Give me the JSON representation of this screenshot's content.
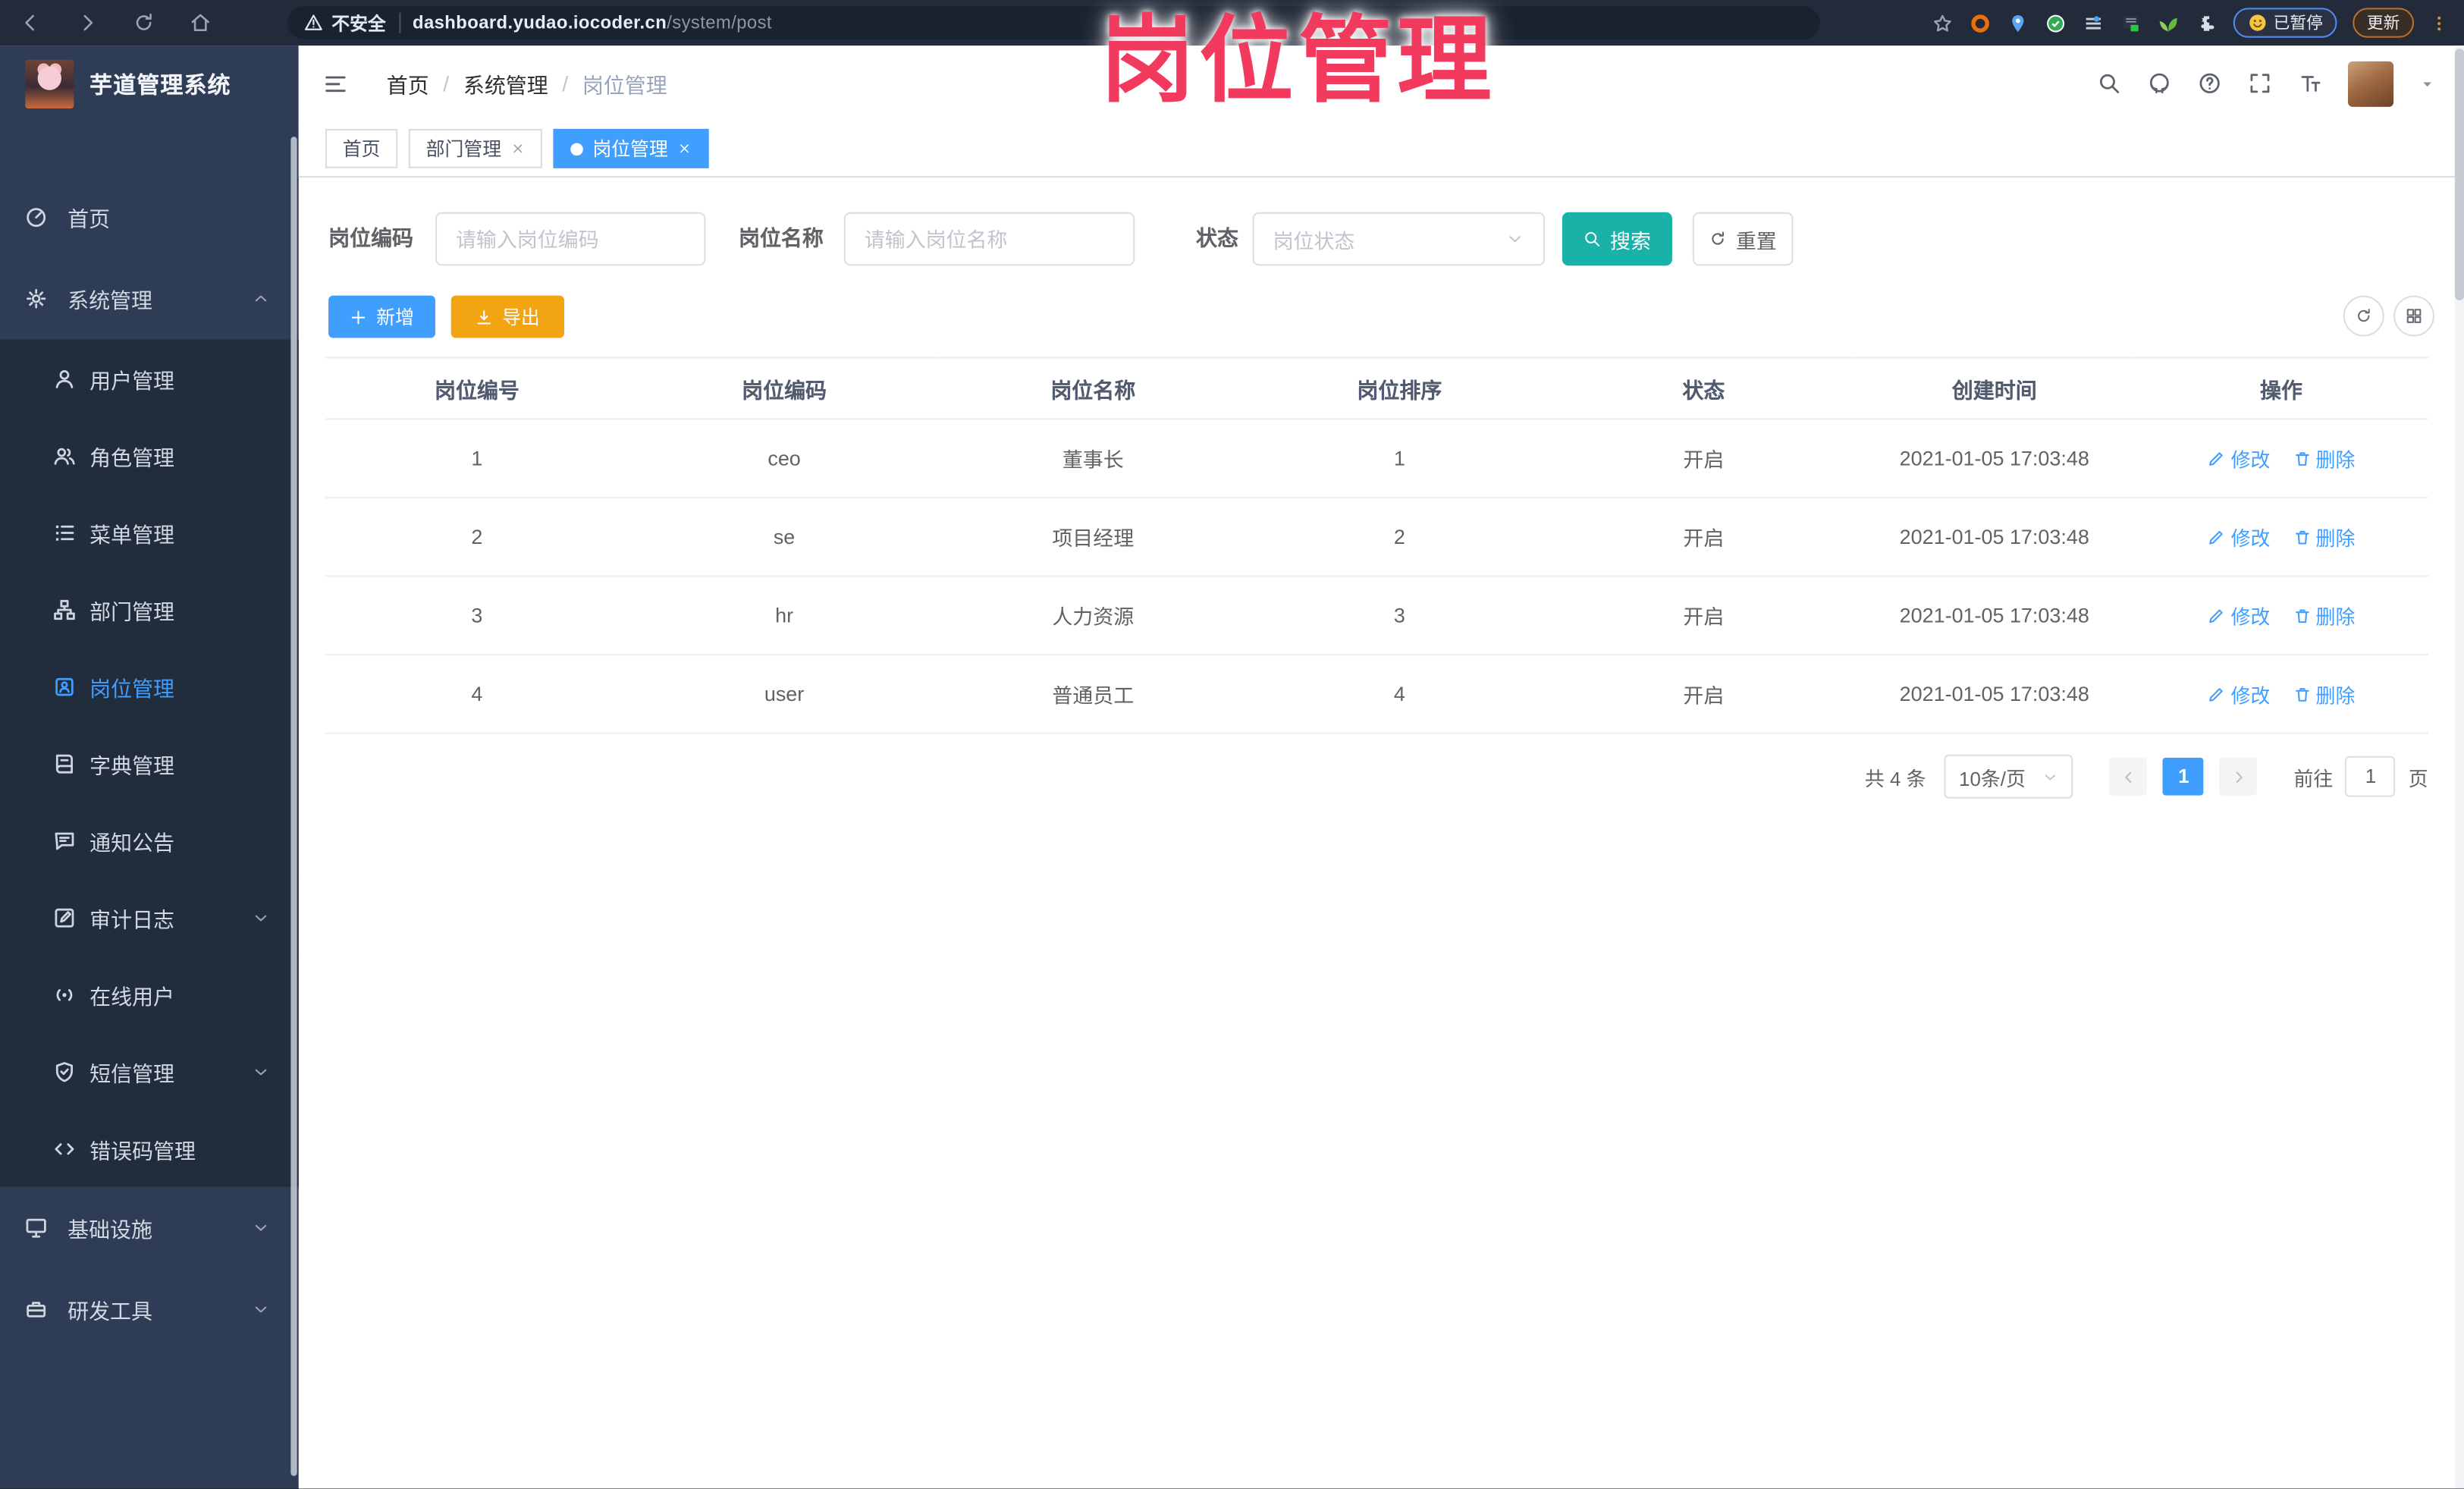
{
  "colors": {
    "primary": "#409eff",
    "search": "#18b2a8",
    "export": "#f2a412",
    "watermark": "#f23a5e"
  },
  "watermark": "岗位管理",
  "browser": {
    "security_label": "不安全",
    "url_domain": "dashboard.yudao.iocoder.cn",
    "url_path": "/system/post",
    "paused_badge": "已暂停",
    "update_button": "更新"
  },
  "sidebar": {
    "title": "芋道管理系统",
    "items": [
      {
        "icon": "dashboard",
        "label": "首页",
        "level": "root"
      },
      {
        "icon": "gear",
        "label": "系统管理",
        "level": "root",
        "chevron": "up"
      },
      {
        "icon": "user",
        "label": "用户管理",
        "level": "sub"
      },
      {
        "icon": "users",
        "label": "角色管理",
        "level": "sub"
      },
      {
        "icon": "list",
        "label": "菜单管理",
        "level": "sub"
      },
      {
        "icon": "tree",
        "label": "部门管理",
        "level": "sub"
      },
      {
        "icon": "badge",
        "label": "岗位管理",
        "level": "sub",
        "active": true
      },
      {
        "icon": "book",
        "label": "字典管理",
        "level": "sub"
      },
      {
        "icon": "bubble",
        "label": "通知公告",
        "level": "sub"
      },
      {
        "icon": "editlog",
        "label": "审计日志",
        "level": "sub",
        "chevron": "down"
      },
      {
        "icon": "online",
        "label": "在线用户",
        "level": "sub"
      },
      {
        "icon": "shield",
        "label": "短信管理",
        "level": "sub",
        "chevron": "down"
      },
      {
        "icon": "code",
        "label": "错误码管理",
        "level": "sub"
      },
      {
        "icon": "infra",
        "label": "基础设施",
        "level": "root",
        "chevron": "down"
      },
      {
        "icon": "tools",
        "label": "研发工具",
        "level": "root",
        "chevron": "down"
      }
    ]
  },
  "header": {
    "breadcrumb": [
      "首页",
      "系统管理",
      "岗位管理"
    ]
  },
  "tabs": [
    {
      "label": "首页"
    },
    {
      "label": "部门管理",
      "closable": true
    },
    {
      "label": "岗位管理",
      "closable": true,
      "active": true
    }
  ],
  "filters": {
    "code_label": "岗位编码",
    "code_placeholder": "请输入岗位编码",
    "name_label": "岗位名称",
    "name_placeholder": "请输入岗位名称",
    "status_label": "状态",
    "status_placeholder": "岗位状态",
    "search_label": "搜索",
    "reset_label": "重置"
  },
  "toolbar": {
    "add_label": "新增",
    "export_label": "导出"
  },
  "table": {
    "columns": [
      "岗位编号",
      "岗位编码",
      "岗位名称",
      "岗位排序",
      "状态",
      "创建时间",
      "操作"
    ],
    "edit_label": "修改",
    "delete_label": "删除",
    "rows": [
      {
        "id": "1",
        "code": "ceo",
        "name": "董事长",
        "sort": "1",
        "status": "开启",
        "created": "2021-01-05 17:03:48"
      },
      {
        "id": "2",
        "code": "se",
        "name": "项目经理",
        "sort": "2",
        "status": "开启",
        "created": "2021-01-05 17:03:48"
      },
      {
        "id": "3",
        "code": "hr",
        "name": "人力资源",
        "sort": "3",
        "status": "开启",
        "created": "2021-01-05 17:03:48"
      },
      {
        "id": "4",
        "code": "user",
        "name": "普通员工",
        "sort": "4",
        "status": "开启",
        "created": "2021-01-05 17:03:48"
      }
    ]
  },
  "pagination": {
    "total": "共 4 条",
    "page_size": "10条/页",
    "current": "1",
    "goto_label": "前往",
    "goto_value": "1",
    "page_suffix": "页"
  }
}
